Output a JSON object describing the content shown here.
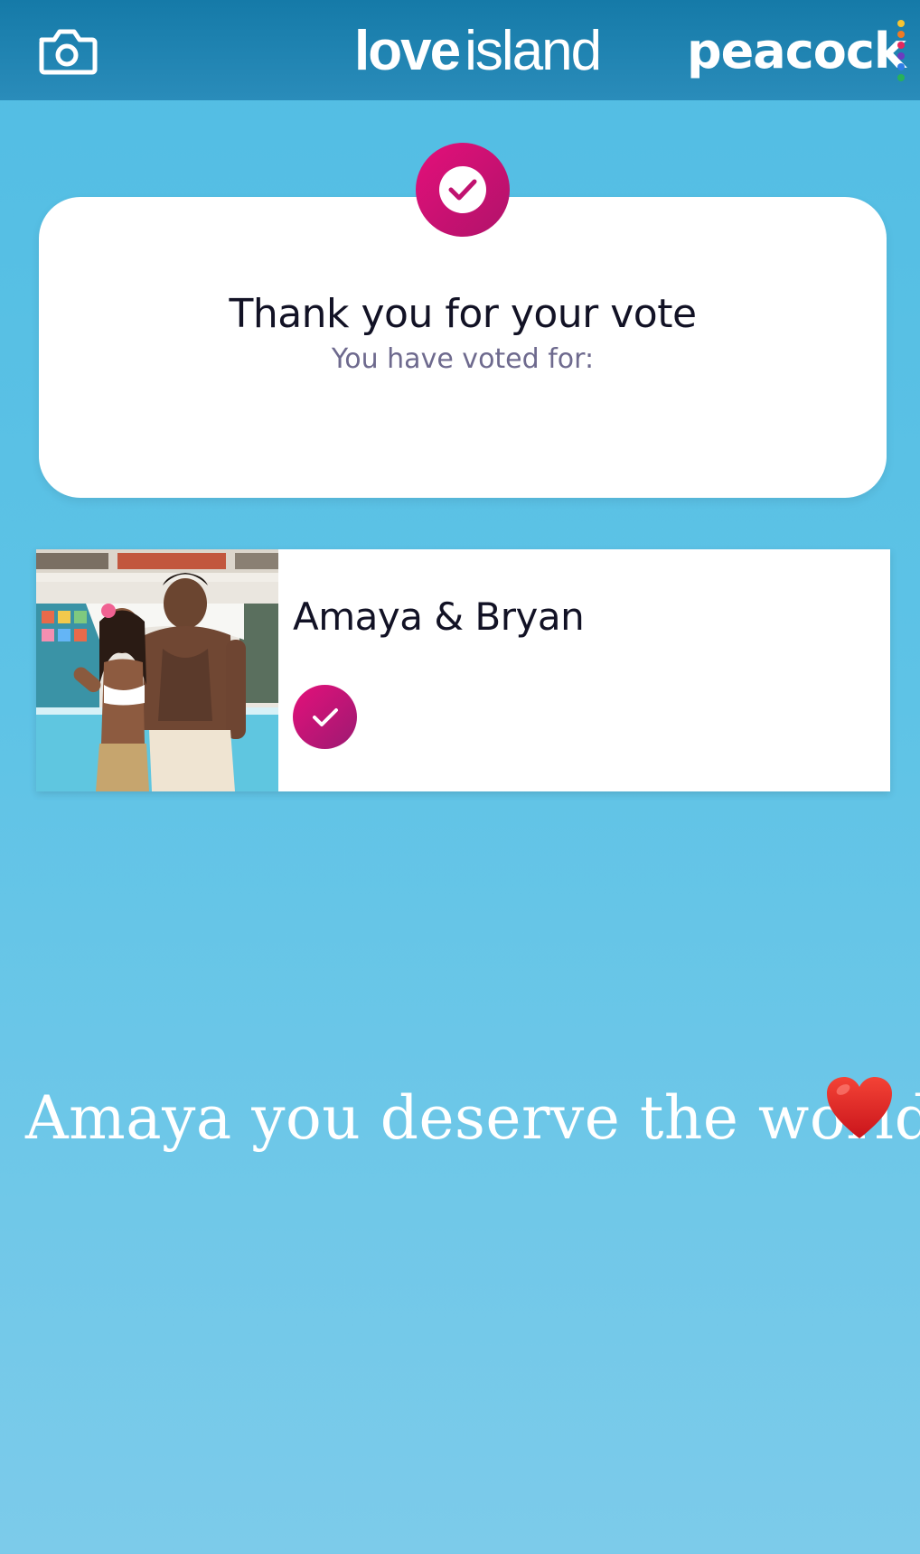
{
  "header": {
    "camera_icon": "camera-icon",
    "brand_word_1": "love",
    "brand_word_2": "island",
    "partner_logo": "peacock",
    "partner_dot_colors": [
      "#f6c431",
      "#ef7a24",
      "#e3285f",
      "#6d3bbf",
      "#2f7fe6",
      "#27b15a"
    ]
  },
  "confirmation": {
    "icon": "check-icon",
    "title": "Thank you for your vote",
    "subtitle": "You have voted for:"
  },
  "vote": {
    "couple_name": "Amaya & Bryan",
    "selected_icon": "check-icon"
  },
  "story": {
    "caption": "Amaya you deserve the world",
    "emoji": "red-heart"
  },
  "colors": {
    "header_bg": "#1b80ae",
    "page_bg": "#5ec3e6",
    "accent_pink": "#e4107a",
    "title_text": "#121225",
    "subtitle_text": "#6e6a8e"
  }
}
